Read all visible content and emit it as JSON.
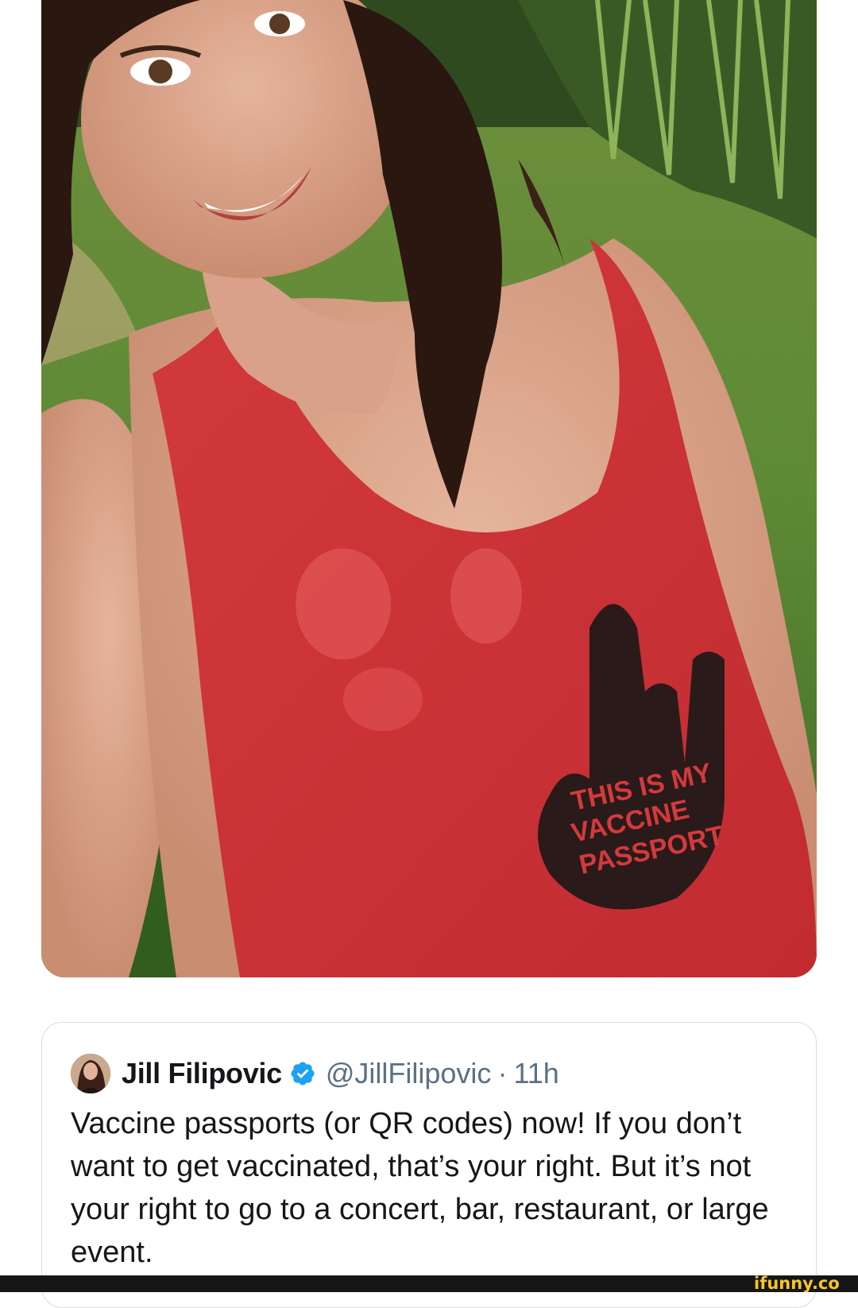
{
  "tweet": {
    "display_name": "Jill Filipovic",
    "handle": "@JillFilipovic",
    "separator": "·",
    "time": "11h",
    "text": "Vaccine passports (or QR codes) now! If you don’t want to get vaccinated, that’s your right. But it’s not your right to go to a concert, bar, restaurant, or large event.",
    "verified": true
  },
  "shirt": {
    "printed_text": [
      "THIS IS MY",
      "VACCINE",
      "PASSPORT"
    ]
  },
  "watermark": {
    "brand_text": "ifunny.co"
  },
  "colors": {
    "verified_blue": "#1da1f2",
    "text_primary": "#14171a",
    "text_secondary": "#5b7083",
    "card_border": "#d6dde3",
    "shirt_red": "#d93a3e",
    "watermark_yellow": "#f7c52b"
  },
  "icons": {
    "verified": "verified-badge-icon",
    "avatar": "profile-avatar"
  }
}
